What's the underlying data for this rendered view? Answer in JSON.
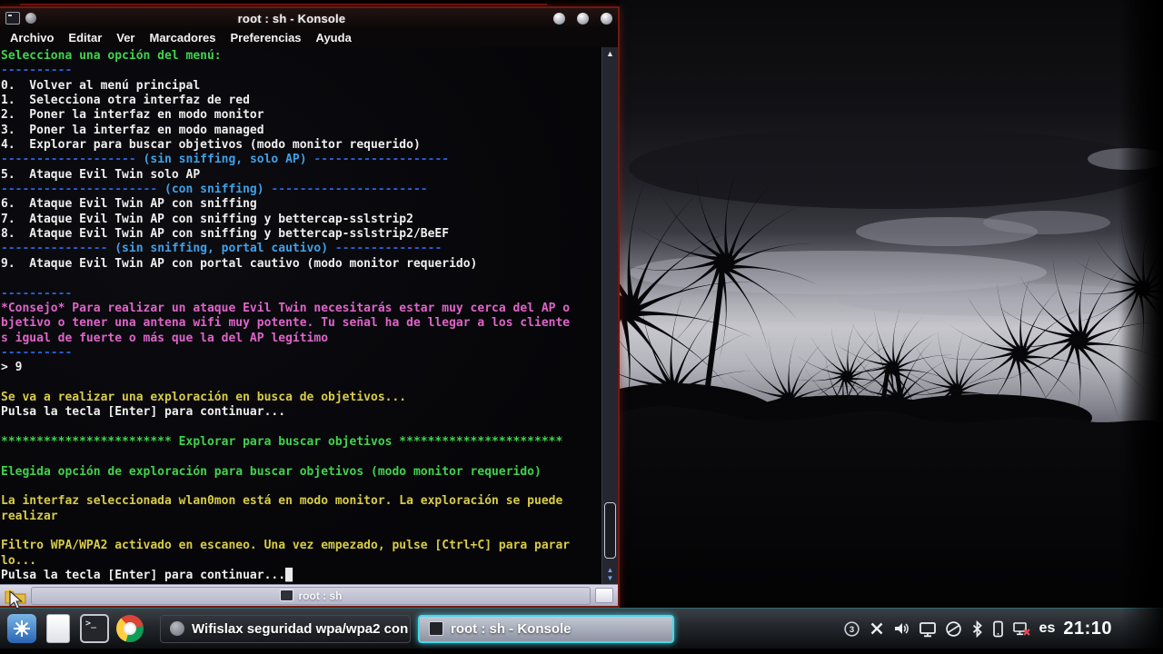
{
  "titlebar": {
    "title": "root : sh - Konsole"
  },
  "menubar": {
    "items": [
      "Archivo",
      "Editar",
      "Ver",
      "Marcadores",
      "Preferencias",
      "Ayuda"
    ]
  },
  "terminal": {
    "lines": [
      [
        [
          "green",
          "Selecciona una opción del menú:"
        ]
      ],
      [
        [
          "blue",
          "----------"
        ]
      ],
      [
        [
          "white",
          "0.  Volver al menú principal"
        ]
      ],
      [
        [
          "white",
          "1.  Selecciona otra interfaz de red"
        ]
      ],
      [
        [
          "white",
          "2.  Poner la interfaz en modo monitor"
        ]
      ],
      [
        [
          "white",
          "3.  Poner la interfaz en modo managed"
        ]
      ],
      [
        [
          "white",
          "4.  Explorar para buscar objetivos (modo monitor requerido)"
        ]
      ],
      [
        [
          "blue",
          "------------------- "
        ],
        [
          "cyan",
          "(sin sniffing, solo AP)"
        ],
        [
          "blue",
          " -------------------"
        ]
      ],
      [
        [
          "white",
          "5.  Ataque Evil Twin solo AP"
        ]
      ],
      [
        [
          "blue",
          "---------------------- "
        ],
        [
          "cyan",
          "(con sniffing)"
        ],
        [
          "blue",
          " ----------------------"
        ]
      ],
      [
        [
          "white",
          "6.  Ataque Evil Twin AP con sniffing"
        ]
      ],
      [
        [
          "white",
          "7.  Ataque Evil Twin AP con sniffing y bettercap-sslstrip2"
        ]
      ],
      [
        [
          "white",
          "8.  Ataque Evil Twin AP con sniffing y bettercap-sslstrip2/BeEF"
        ]
      ],
      [
        [
          "blue",
          "--------------- "
        ],
        [
          "cyan",
          "(sin sniffing, portal cautivo)"
        ],
        [
          "blue",
          " ---------------"
        ]
      ],
      [
        [
          "white",
          "9.  Ataque Evil Twin AP con portal cautivo (modo monitor requerido)"
        ]
      ],
      [],
      [
        [
          "blue",
          "----------"
        ]
      ],
      [
        [
          "pink",
          "*Consejo* Para realizar un ataque Evil Twin necesitarás estar muy cerca del AP o"
        ]
      ],
      [
        [
          "pink",
          "bjetivo o tener una antena wifi muy potente. Tu señal ha de llegar a los cliente"
        ]
      ],
      [
        [
          "pink",
          "s igual de fuerte o más que la del AP legítimo"
        ]
      ],
      [
        [
          "blue",
          "----------"
        ]
      ],
      [
        [
          "white",
          "> 9"
        ]
      ],
      [],
      [
        [
          "yellow",
          "Se va a realizar una exploración en busca de objetivos..."
        ]
      ],
      [
        [
          "white",
          "Pulsa la tecla [Enter] para continuar..."
        ]
      ],
      [],
      [
        [
          "green",
          "************************ Explorar para buscar objetivos ***********************"
        ]
      ],
      [],
      [
        [
          "green",
          "Elegida opción de exploración para buscar objetivos (modo monitor requerido)"
        ]
      ],
      [],
      [
        [
          "yellow",
          "La interfaz seleccionada wlan0mon está en modo monitor. La exploración se puede"
        ]
      ],
      [
        [
          "yellow",
          "realizar"
        ]
      ],
      [],
      [
        [
          "yellow",
          "Filtro WPA/WPA2 activado en escaneo. Una vez empezado, pulse [Ctrl+C] para parar"
        ]
      ],
      [
        [
          "yellow",
          "lo..."
        ]
      ],
      [
        [
          "white",
          "Pulsa la tecla [Enter] para continuar..."
        ],
        [
          "cursor",
          "█"
        ]
      ]
    ]
  },
  "tabbar": {
    "tab_label": "root : sh"
  },
  "taskbar": {
    "buttons": [
      {
        "label": "Wifislax seguridad wpa/wpa2 con",
        "icon": "globe-gray",
        "active": false
      },
      {
        "label": "root : sh - Konsole",
        "icon": "terminal",
        "active": true
      }
    ],
    "launcher_icons": [
      "app-menu",
      "files",
      "terminal",
      "browser"
    ],
    "tray_icons": [
      "badge-3",
      "close-x",
      "volume",
      "display",
      "network-globe",
      "bluetooth",
      "phone",
      "network-offline"
    ],
    "keyboard_layout": "es",
    "clock": "21:10"
  },
  "colors": {
    "terminal_green": "#3fd44a",
    "terminal_blue": "#2a5fd0",
    "terminal_cyan": "#3fa0e8",
    "terminal_pink": "#de64c8",
    "terminal_yellow": "#d9cc47",
    "window_border_red": "#6e1a10",
    "active_task_glow": "#49d8e8"
  }
}
